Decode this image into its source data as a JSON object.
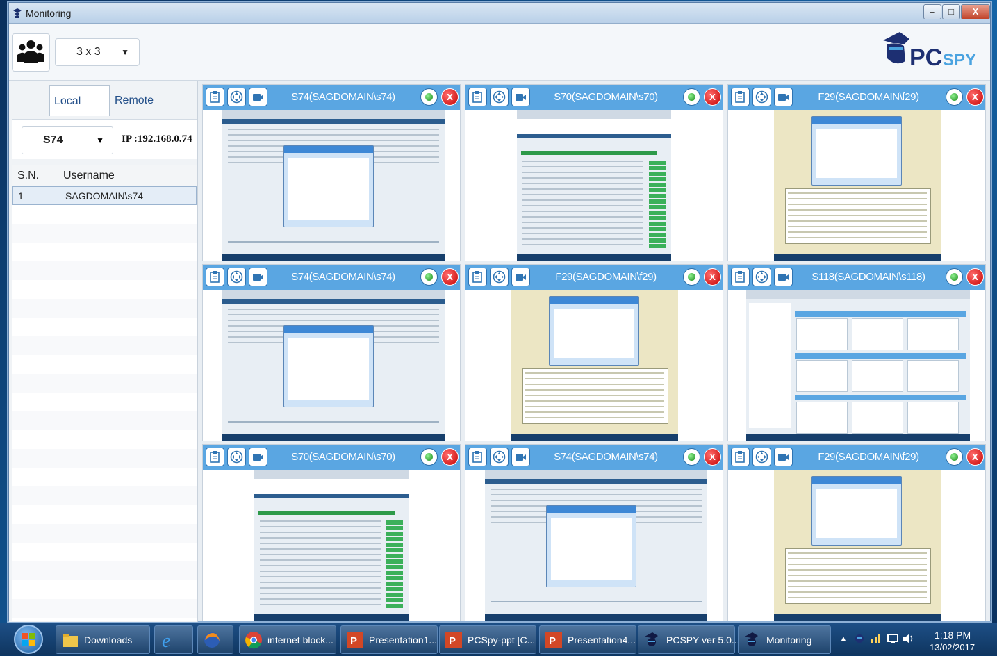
{
  "window": {
    "title": "Monitoring",
    "minimize": "–",
    "maximize": "□",
    "close": "X"
  },
  "toolbar": {
    "grid_layout": "3 x 3",
    "logo_text": "PCSPY"
  },
  "left_panel": {
    "tabs": [
      {
        "label": "Local Users",
        "active": true
      },
      {
        "label": "Remote Users",
        "active": false
      }
    ],
    "selected_user": "S74",
    "ip": "IP :192.168.0.74",
    "table": {
      "columns": [
        "S.N.",
        "Username"
      ],
      "rows": [
        {
          "sn": "1",
          "username": "SAGDOMAIN\\s74"
        }
      ]
    }
  },
  "cells": [
    {
      "title": "S74(SAGDOMAIN\\s74)",
      "kind": "client"
    },
    {
      "title": "S70(SAGDOMAIN\\s70)",
      "kind": "sag"
    },
    {
      "title": "F29(SAGDOMAIN\\f29)",
      "kind": "history"
    },
    {
      "title": "S74(SAGDOMAIN\\s74)",
      "kind": "client"
    },
    {
      "title": "F29(SAGDOMAIN\\f29)",
      "kind": "history"
    },
    {
      "title": "S118(SAGDOMAIN\\s118)",
      "kind": "grid"
    },
    {
      "title": "S70(SAGDOMAIN\\s70)",
      "kind": "sag"
    },
    {
      "title": "S74(SAGDOMAIN\\s74)",
      "kind": "client"
    },
    {
      "title": "F29(SAGDOMAIN\\f29)",
      "kind": "history"
    }
  ],
  "taskbar": {
    "items": [
      {
        "label": "Downloads",
        "icon": "folder-icon"
      },
      {
        "label": "",
        "icon": "internet-explorer-icon"
      },
      {
        "label": "",
        "icon": "firefox-icon"
      },
      {
        "label": "internet block...",
        "icon": "chrome-icon"
      },
      {
        "label": "Presentation1...",
        "icon": "powerpoint-icon"
      },
      {
        "label": "PCSpy-ppt [C...",
        "icon": "powerpoint-icon"
      },
      {
        "label": "Presentation4...",
        "icon": "powerpoint-icon"
      },
      {
        "label": "PCSPY ver 5.0...",
        "icon": "pcspy-icon"
      },
      {
        "label": "Monitoring",
        "icon": "pcspy-icon"
      }
    ],
    "clock_time": "1:18 PM",
    "clock_date": "13/02/2017"
  }
}
